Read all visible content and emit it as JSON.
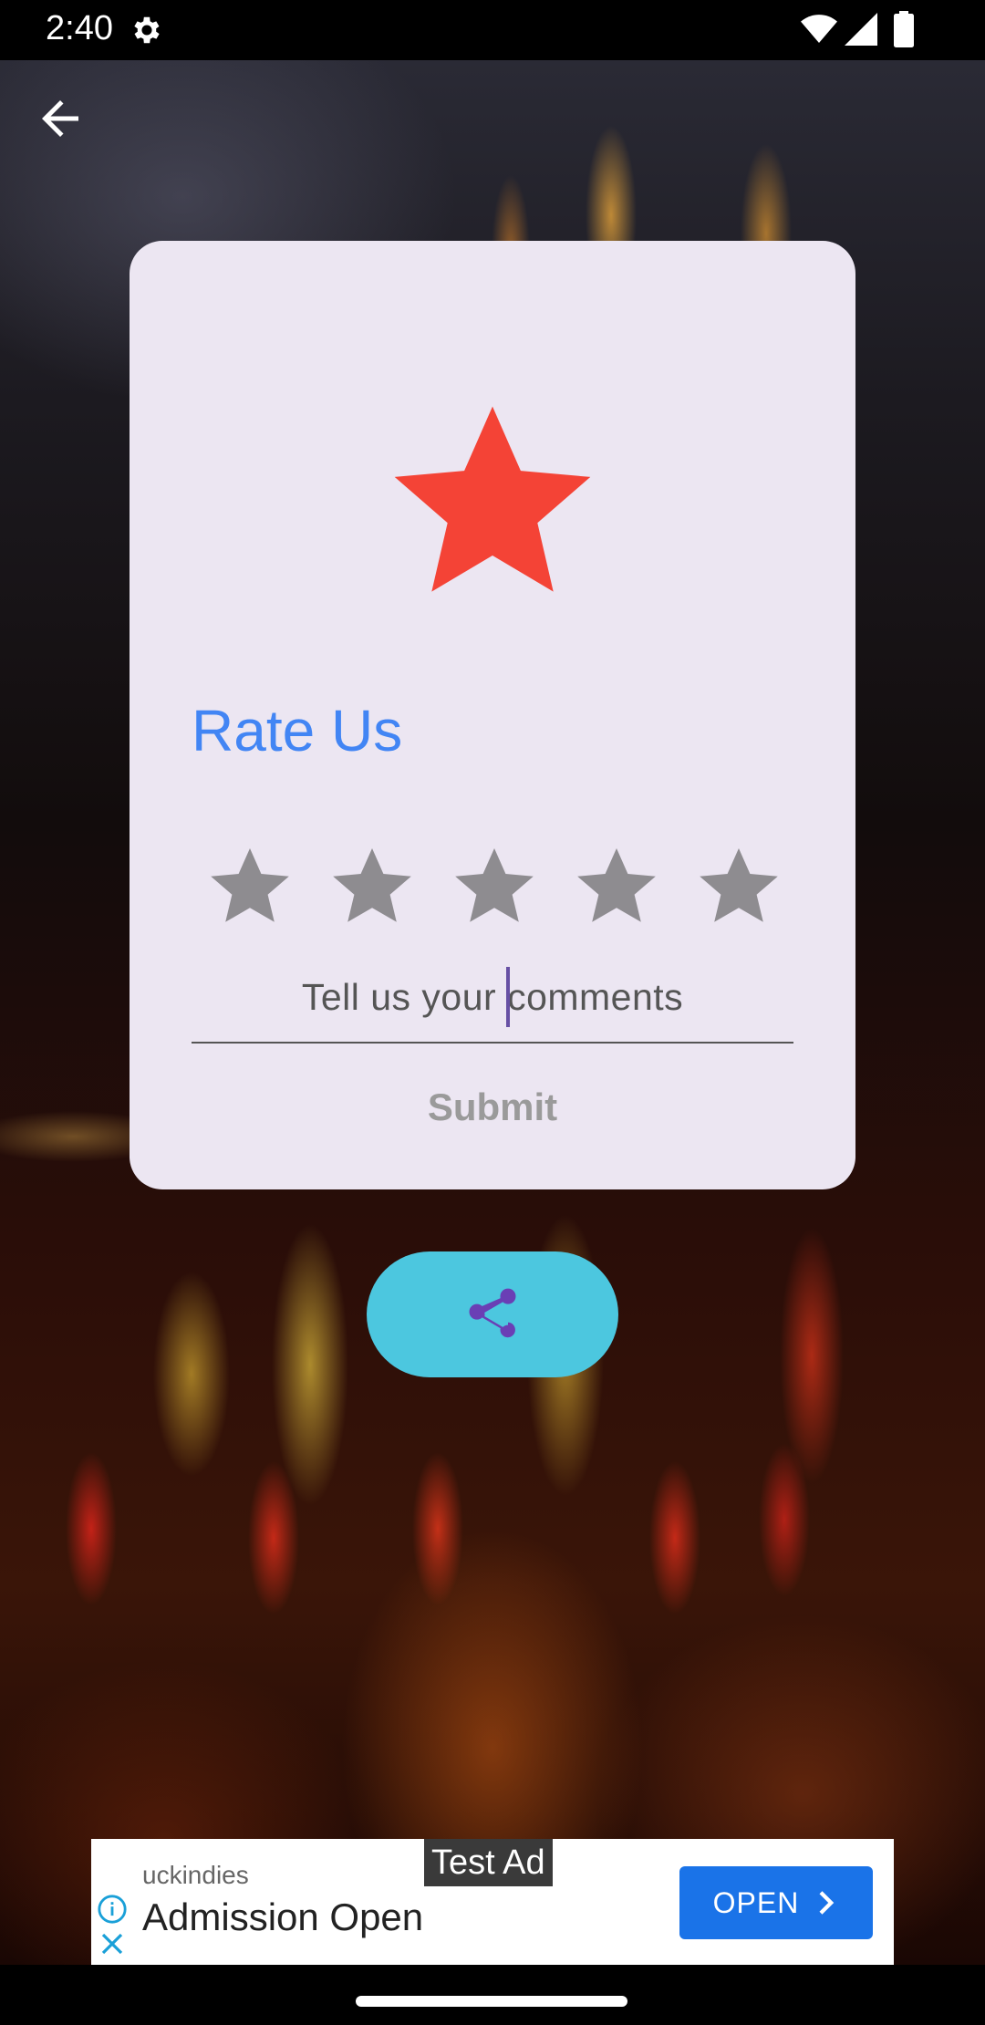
{
  "status_bar": {
    "time": "2:40",
    "icons": [
      "settings-icon",
      "wifi-icon",
      "signal-icon",
      "battery-icon"
    ]
  },
  "toolbar": {
    "back_icon": "arrow-back-icon"
  },
  "dialog": {
    "hero_icon": "star-icon",
    "hero_color": "#f44336",
    "title": "Rate Us",
    "title_color": "#4285f4",
    "rating": {
      "max": 5,
      "value": 0,
      "star_color": "#8e8c90"
    },
    "comment": {
      "text": "Tell us your comments"
    },
    "submit_label": "Submit"
  },
  "share": {
    "icon": "share-icon",
    "color": "#4cc7df"
  },
  "ad": {
    "tag": "Test Ad",
    "advertiser": "uckindies",
    "headline": "Admission Open",
    "cta_label": "OPEN",
    "cta_color": "#1a73e8"
  }
}
